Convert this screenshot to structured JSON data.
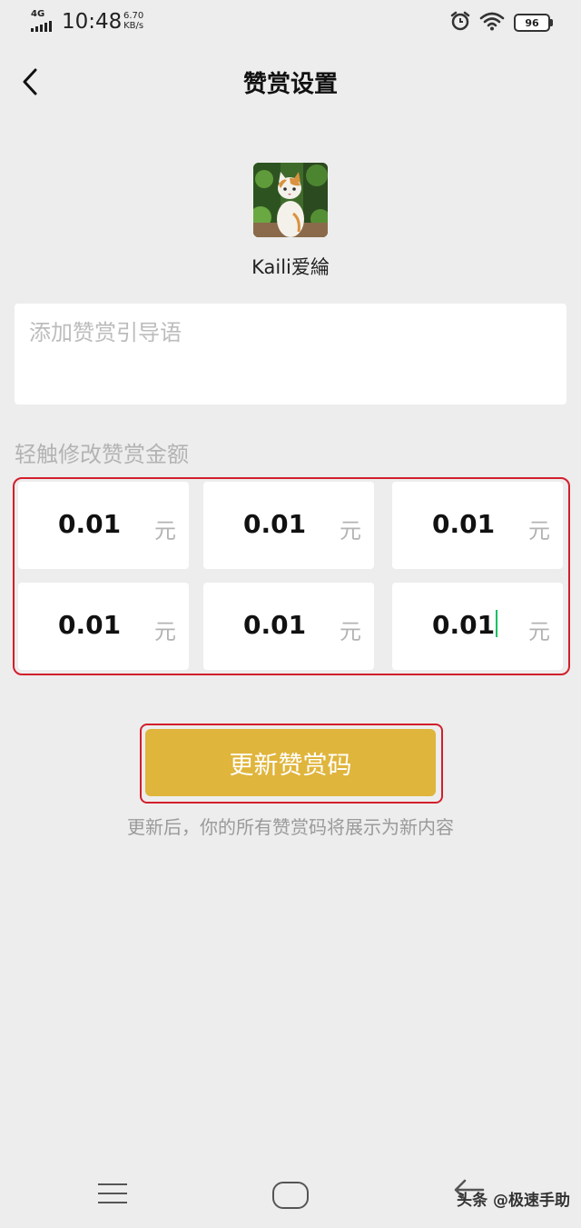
{
  "status_bar": {
    "network": "4G",
    "time": "10:48",
    "speed_value": "6.70",
    "speed_unit": "KB/s",
    "battery": "96",
    "icons": [
      "signal-icon",
      "alarm-icon",
      "wifi-icon",
      "battery-icon"
    ]
  },
  "header": {
    "title": "赞赏设置",
    "back_icon": "chevron-left-icon"
  },
  "profile": {
    "username": "Kaili爱綸",
    "avatar": "cat-photo"
  },
  "guide": {
    "placeholder": "添加赞赏引导语",
    "value": ""
  },
  "amounts": {
    "label": "轻触修改赞赏金额",
    "unit": "元",
    "items": [
      {
        "value": "0.01"
      },
      {
        "value": "0.01"
      },
      {
        "value": "0.01"
      },
      {
        "value": "0.01"
      },
      {
        "value": "0.01"
      },
      {
        "value": "0.01"
      }
    ],
    "focused_index": 5
  },
  "actions": {
    "update_label": "更新赞赏码",
    "hint": "更新后，你的所有赞赏码将展示为新内容"
  },
  "system_nav": {
    "icons": [
      "menu-icon",
      "home-icon",
      "back-arrow-icon"
    ],
    "watermark": "头条 @极速手助"
  },
  "colors": {
    "accent": "#e0b53c",
    "highlight": "#d21f2c",
    "caret": "#07c160",
    "background": "#ededed"
  }
}
